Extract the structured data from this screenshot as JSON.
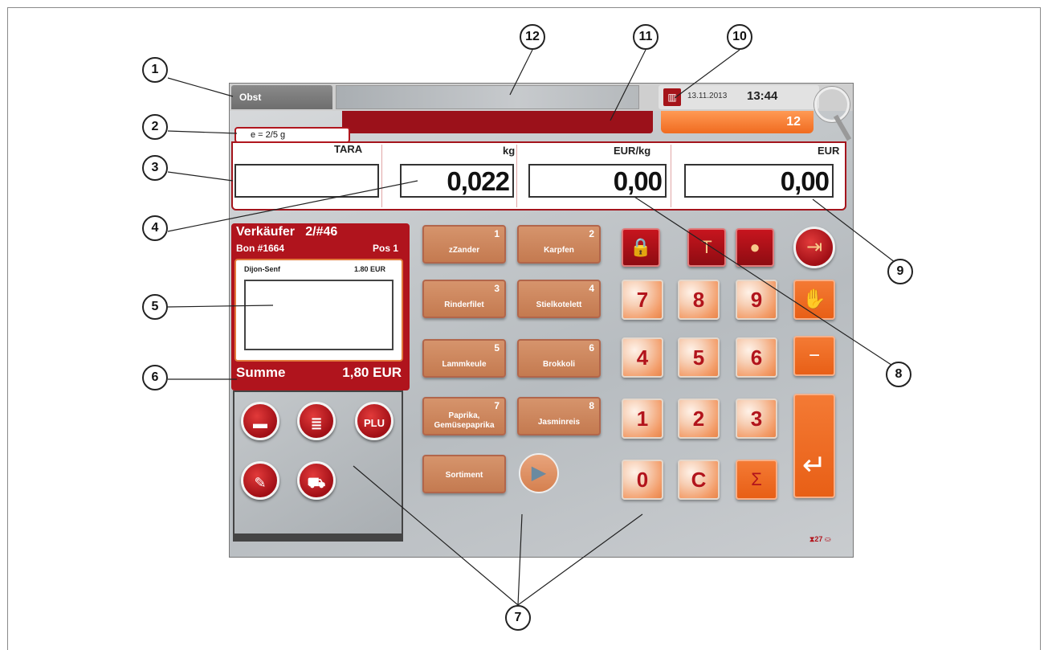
{
  "callouts": [
    "1",
    "2",
    "3",
    "4",
    "5",
    "6",
    "7",
    "8",
    "9",
    "10",
    "11",
    "12"
  ],
  "header": {
    "tab_label": "Obst",
    "date": "13.11.2013",
    "time": "13:44",
    "counter": "12"
  },
  "scale_info": "e = 2/5 g",
  "weighing": {
    "tare_label": "TARA",
    "tare_value": "",
    "weight_label": "kg",
    "weight_value": "0,022",
    "unit_price_label": "EUR/kg",
    "unit_price_value": "0,00",
    "price_label": "EUR",
    "price_value": "0,00"
  },
  "receipt": {
    "seller": "Verkäufer",
    "seller_id": "2/#46",
    "bon": "Bon #1664",
    "pos": "Pos 1",
    "item_name": "Dijon-Senf",
    "item_price": "1.80 EUR",
    "sum_label": "Summe",
    "sum_value": "1,80 EUR"
  },
  "function_buttons": [
    "printer-icon",
    "receipt-icon",
    "PLU",
    "tools-icon",
    "cart-icon"
  ],
  "plu_label": "PLU",
  "plu_items": [
    {
      "num": "1",
      "label": "zZander"
    },
    {
      "num": "2",
      "label": "Karpfen"
    },
    {
      "num": "3",
      "label": "Rinderfilet"
    },
    {
      "num": "4",
      "label": "Stielkotelett"
    },
    {
      "num": "5",
      "label": "Lammkeule"
    },
    {
      "num": "6",
      "label": "Brokkoli"
    },
    {
      "num": "7",
      "label": "Paprika, Gemüsepaprika"
    },
    {
      "num": "8",
      "label": "Jasminreis"
    }
  ],
  "sortiment_label": "Sortiment",
  "keypad": {
    "digits": [
      "7",
      "8",
      "9",
      "4",
      "5",
      "6",
      "1",
      "2",
      "3",
      "0"
    ],
    "clear": "C",
    "sum": "Σ",
    "minus": "−"
  },
  "status_count": "27",
  "colors": {
    "brand_red": "#a4141c",
    "orange": "#f06b1f",
    "plu_tan": "#c47a50"
  }
}
